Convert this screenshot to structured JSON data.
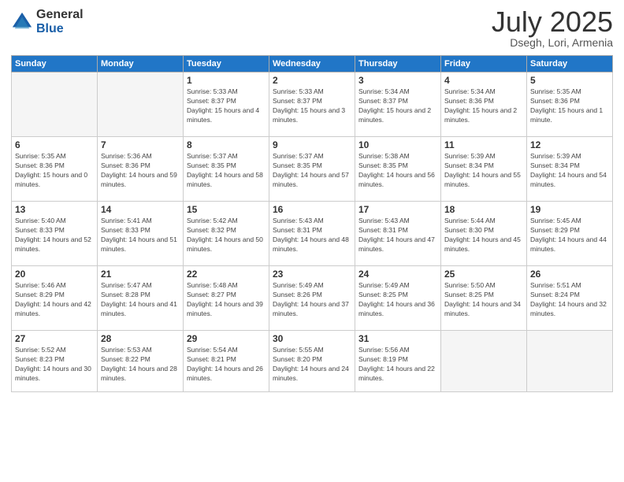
{
  "logo": {
    "general": "General",
    "blue": "Blue"
  },
  "title": {
    "month": "July 2025",
    "location": "Dsegh, Lori, Armenia"
  },
  "weekdays": [
    "Sunday",
    "Monday",
    "Tuesday",
    "Wednesday",
    "Thursday",
    "Friday",
    "Saturday"
  ],
  "weeks": [
    [
      {
        "day": "",
        "empty": true
      },
      {
        "day": "",
        "empty": true
      },
      {
        "day": "1",
        "sunrise": "5:33 AM",
        "sunset": "8:37 PM",
        "daylight": "15 hours and 4 minutes."
      },
      {
        "day": "2",
        "sunrise": "5:33 AM",
        "sunset": "8:37 PM",
        "daylight": "15 hours and 3 minutes."
      },
      {
        "day": "3",
        "sunrise": "5:34 AM",
        "sunset": "8:37 PM",
        "daylight": "15 hours and 2 minutes."
      },
      {
        "day": "4",
        "sunrise": "5:34 AM",
        "sunset": "8:36 PM",
        "daylight": "15 hours and 2 minutes."
      },
      {
        "day": "5",
        "sunrise": "5:35 AM",
        "sunset": "8:36 PM",
        "daylight": "15 hours and 1 minute."
      }
    ],
    [
      {
        "day": "6",
        "sunrise": "5:35 AM",
        "sunset": "8:36 PM",
        "daylight": "15 hours and 0 minutes."
      },
      {
        "day": "7",
        "sunrise": "5:36 AM",
        "sunset": "8:36 PM",
        "daylight": "14 hours and 59 minutes."
      },
      {
        "day": "8",
        "sunrise": "5:37 AM",
        "sunset": "8:35 PM",
        "daylight": "14 hours and 58 minutes."
      },
      {
        "day": "9",
        "sunrise": "5:37 AM",
        "sunset": "8:35 PM",
        "daylight": "14 hours and 57 minutes."
      },
      {
        "day": "10",
        "sunrise": "5:38 AM",
        "sunset": "8:35 PM",
        "daylight": "14 hours and 56 minutes."
      },
      {
        "day": "11",
        "sunrise": "5:39 AM",
        "sunset": "8:34 PM",
        "daylight": "14 hours and 55 minutes."
      },
      {
        "day": "12",
        "sunrise": "5:39 AM",
        "sunset": "8:34 PM",
        "daylight": "14 hours and 54 minutes."
      }
    ],
    [
      {
        "day": "13",
        "sunrise": "5:40 AM",
        "sunset": "8:33 PM",
        "daylight": "14 hours and 52 minutes."
      },
      {
        "day": "14",
        "sunrise": "5:41 AM",
        "sunset": "8:33 PM",
        "daylight": "14 hours and 51 minutes."
      },
      {
        "day": "15",
        "sunrise": "5:42 AM",
        "sunset": "8:32 PM",
        "daylight": "14 hours and 50 minutes."
      },
      {
        "day": "16",
        "sunrise": "5:43 AM",
        "sunset": "8:31 PM",
        "daylight": "14 hours and 48 minutes."
      },
      {
        "day": "17",
        "sunrise": "5:43 AM",
        "sunset": "8:31 PM",
        "daylight": "14 hours and 47 minutes."
      },
      {
        "day": "18",
        "sunrise": "5:44 AM",
        "sunset": "8:30 PM",
        "daylight": "14 hours and 45 minutes."
      },
      {
        "day": "19",
        "sunrise": "5:45 AM",
        "sunset": "8:29 PM",
        "daylight": "14 hours and 44 minutes."
      }
    ],
    [
      {
        "day": "20",
        "sunrise": "5:46 AM",
        "sunset": "8:29 PM",
        "daylight": "14 hours and 42 minutes."
      },
      {
        "day": "21",
        "sunrise": "5:47 AM",
        "sunset": "8:28 PM",
        "daylight": "14 hours and 41 minutes."
      },
      {
        "day": "22",
        "sunrise": "5:48 AM",
        "sunset": "8:27 PM",
        "daylight": "14 hours and 39 minutes."
      },
      {
        "day": "23",
        "sunrise": "5:49 AM",
        "sunset": "8:26 PM",
        "daylight": "14 hours and 37 minutes."
      },
      {
        "day": "24",
        "sunrise": "5:49 AM",
        "sunset": "8:25 PM",
        "daylight": "14 hours and 36 minutes."
      },
      {
        "day": "25",
        "sunrise": "5:50 AM",
        "sunset": "8:25 PM",
        "daylight": "14 hours and 34 minutes."
      },
      {
        "day": "26",
        "sunrise": "5:51 AM",
        "sunset": "8:24 PM",
        "daylight": "14 hours and 32 minutes."
      }
    ],
    [
      {
        "day": "27",
        "sunrise": "5:52 AM",
        "sunset": "8:23 PM",
        "daylight": "14 hours and 30 minutes."
      },
      {
        "day": "28",
        "sunrise": "5:53 AM",
        "sunset": "8:22 PM",
        "daylight": "14 hours and 28 minutes."
      },
      {
        "day": "29",
        "sunrise": "5:54 AM",
        "sunset": "8:21 PM",
        "daylight": "14 hours and 26 minutes."
      },
      {
        "day": "30",
        "sunrise": "5:55 AM",
        "sunset": "8:20 PM",
        "daylight": "14 hours and 24 minutes."
      },
      {
        "day": "31",
        "sunrise": "5:56 AM",
        "sunset": "8:19 PM",
        "daylight": "14 hours and 22 minutes."
      },
      {
        "day": "",
        "empty": true
      },
      {
        "day": "",
        "empty": true
      }
    ]
  ]
}
